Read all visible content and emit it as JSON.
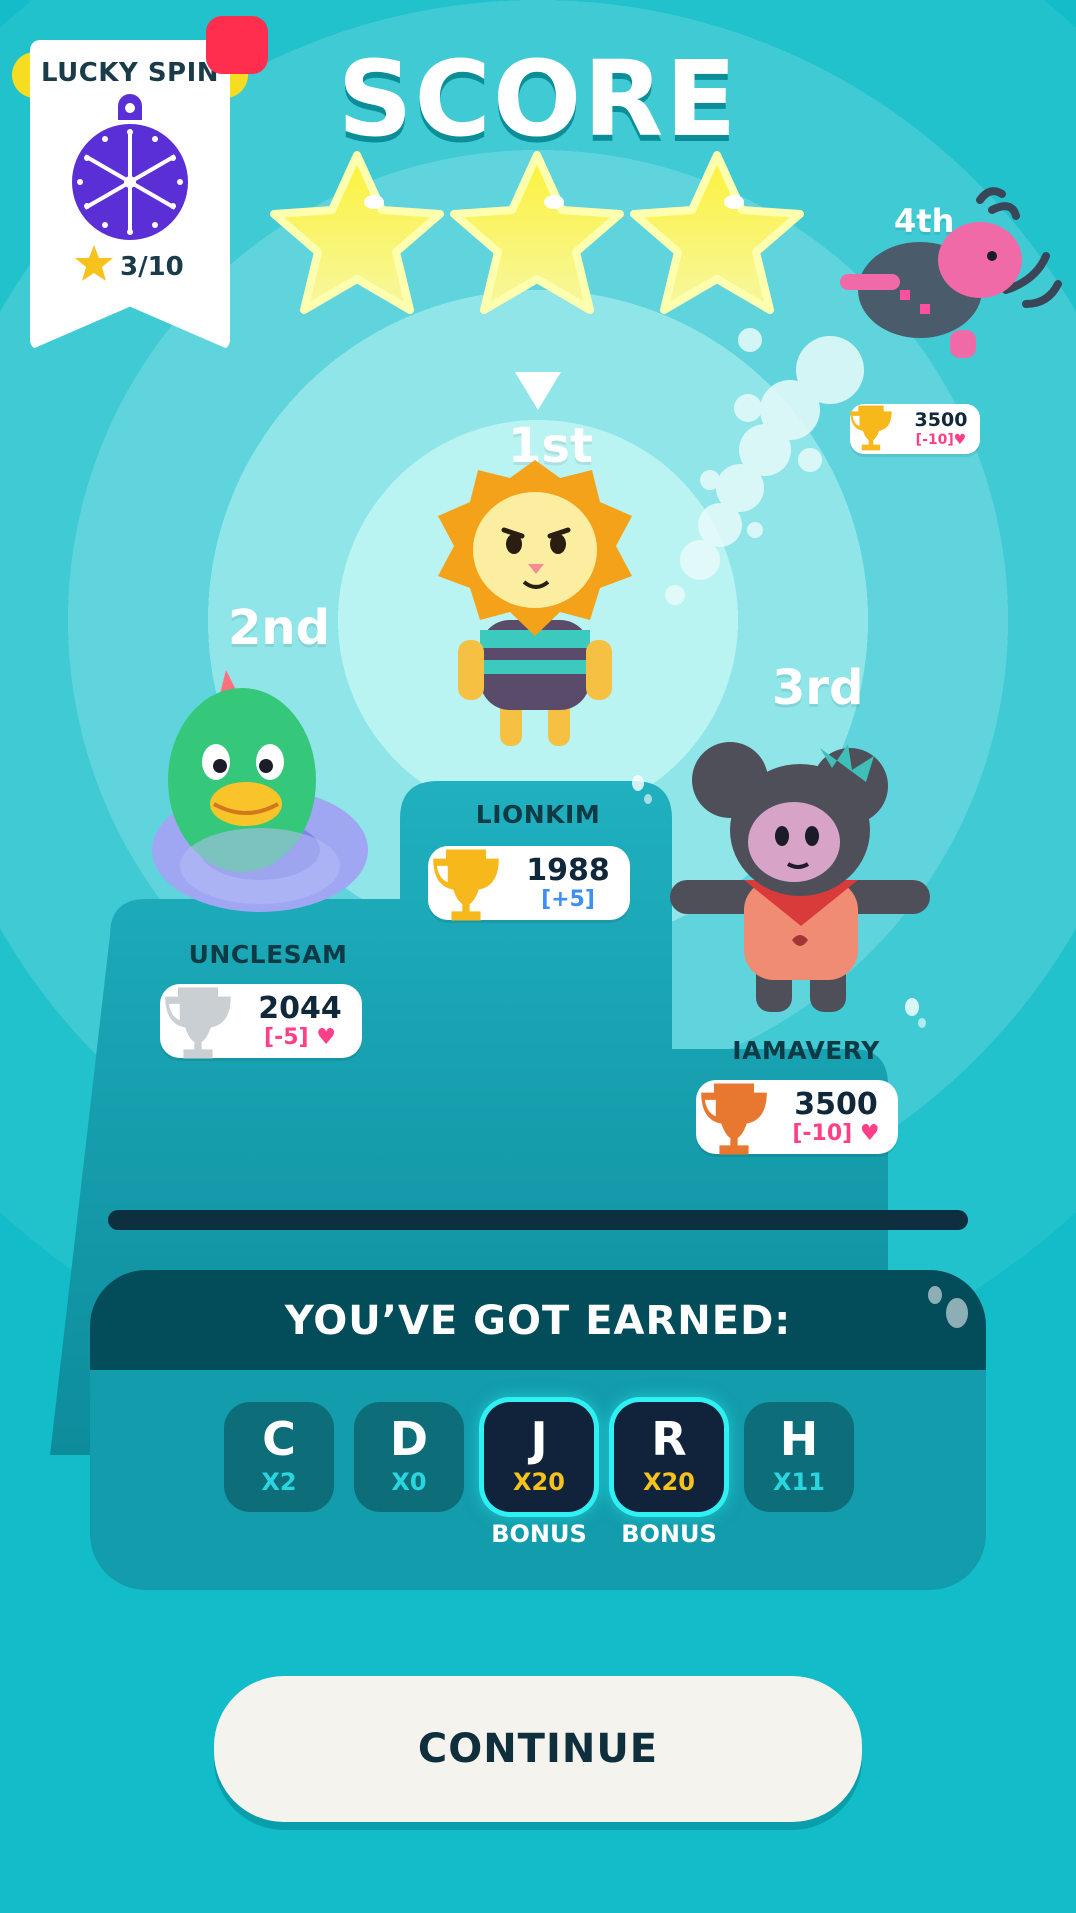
{
  "colors": {
    "background": "#0fbfcb",
    "panel_header": "#034d5b",
    "panel_body": "#139cab",
    "star": "#f6ee22",
    "gold_trophy": "#f6b81b",
    "silver_trophy": "#c9cfd3",
    "bronze_trophy": "#e8782f",
    "delta_up": "#3f8ff3",
    "delta_down": "#ff3f87",
    "bonus_glow": "#2ff0f2",
    "notification": "#ff2d4e"
  },
  "lucky_spin": {
    "title": "LUCKY SPIN",
    "progress": "3/10",
    "icon": "wheel-pin-icon"
  },
  "header": {
    "title": "SCORE",
    "stars_earned": 3,
    "stars_total": 3
  },
  "podium": {
    "first": {
      "place": "1st",
      "name": "LIONKIM",
      "score": "1988",
      "delta": "[+5]",
      "trophy": "gold-trophy-icon"
    },
    "second": {
      "place": "2nd",
      "name": "UNCLESAM",
      "score": "2044",
      "delta": "[-5]",
      "trophy": "silver-trophy-icon"
    },
    "third": {
      "place": "3rd",
      "name": "IAMAVERY",
      "score": "3500",
      "delta": "[-10]",
      "trophy": "bronze-trophy-icon"
    },
    "fourth": {
      "place": "4th",
      "score": "3500",
      "delta": "[-10]",
      "trophy": "gold-trophy-icon"
    }
  },
  "earned": {
    "title": "YOU’VE GOT EARNED:",
    "items": [
      {
        "letter": "C",
        "multiplier": "X2",
        "bonus": false
      },
      {
        "letter": "D",
        "multiplier": "X0",
        "bonus": false
      },
      {
        "letter": "J",
        "multiplier": "X20",
        "bonus": true,
        "bonus_label": "BONUS"
      },
      {
        "letter": "R",
        "multiplier": "X20",
        "bonus": true,
        "bonus_label": "BONUS"
      },
      {
        "letter": "H",
        "multiplier": "X11",
        "bonus": false
      }
    ]
  },
  "continue_label": "CONTINUE"
}
